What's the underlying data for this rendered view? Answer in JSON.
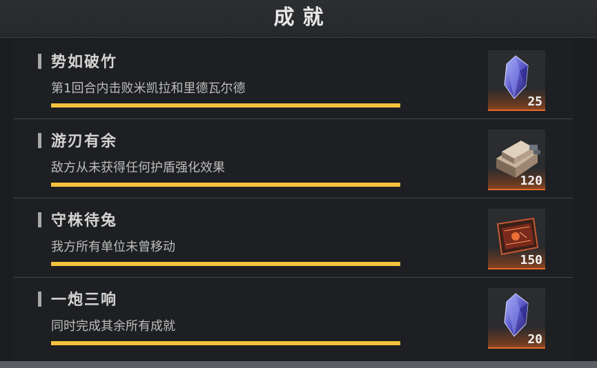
{
  "header": {
    "title": "成就"
  },
  "achievements": [
    {
      "title": "势如破竹",
      "description": "第1回合内击败米凯拉和里德瓦尔德",
      "progress": 1.0,
      "reward": {
        "icon": "crystal-icon",
        "count": "25"
      }
    },
    {
      "title": "游刃有余",
      "description": "敌方从未获得任何护盾强化效果",
      "progress": 1.0,
      "reward": {
        "icon": "metal-ingot-icon",
        "count": "120"
      }
    },
    {
      "title": "守株待兔",
      "description": "我方所有单位未曾移动",
      "progress": 1.0,
      "reward": {
        "icon": "circuit-board-icon",
        "count": "150"
      }
    },
    {
      "title": "一炮三响",
      "description": "同时完成其余所有成就",
      "progress": 1.0,
      "reward": {
        "icon": "crystal-icon",
        "count": "20"
      }
    }
  ],
  "colors": {
    "progress_fill": "#f4c13d",
    "reward_glow": "#e66a2a",
    "background": "#1b1d20"
  }
}
